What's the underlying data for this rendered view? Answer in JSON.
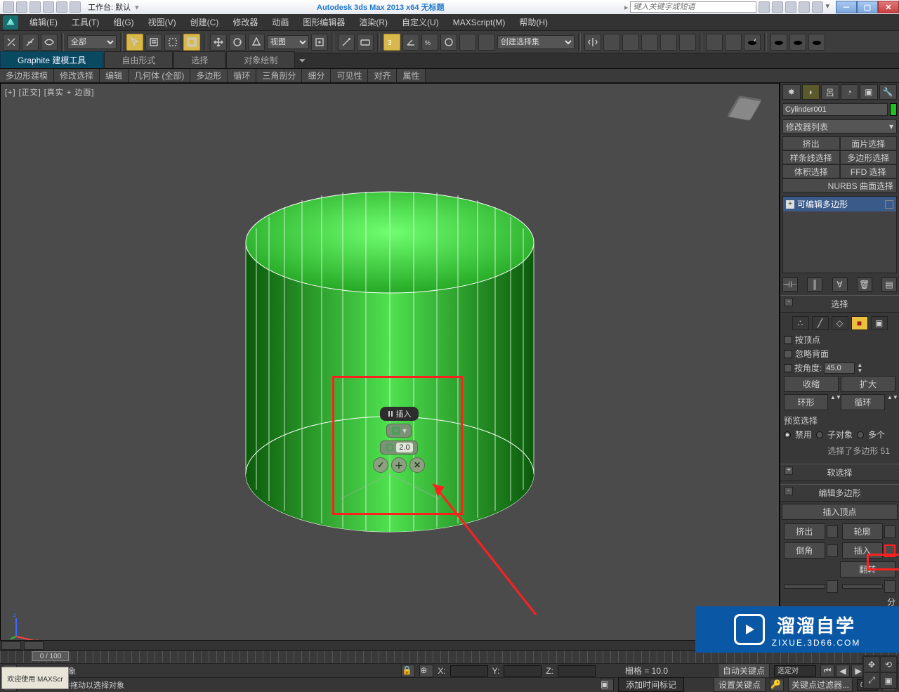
{
  "titlebar": {
    "workspace": "工作台: 默认",
    "app_title": "Autodesk 3ds Max  2013 x64      无标题",
    "search_placeholder": "键入关键字或短语"
  },
  "menu": [
    "编辑(E)",
    "工具(T)",
    "组(G)",
    "视图(V)",
    "创建(C)",
    "修改器",
    "动画",
    "图形编辑器",
    "渲染(R)",
    "自定义(U)",
    "MAXScript(M)",
    "帮助(H)"
  ],
  "main_toolbar": {
    "selection_filter": "全部",
    "ref_coord": "视图",
    "named_sel_set": "创建选择集"
  },
  "ribbon": {
    "tabs": [
      "Graphite 建模工具",
      "自由形式",
      "选择",
      "对象绘制"
    ],
    "panels": [
      "多边形建模",
      "修改选择",
      "编辑",
      "几何体 (全部)",
      "多边形",
      "循环",
      "三角剖分",
      "细分",
      "可见性",
      "对齐",
      "属性"
    ]
  },
  "viewport": {
    "label": "[+] [正交] [真实 + 边面]"
  },
  "caddy": {
    "title": "插入",
    "value": "2.0"
  },
  "cmdpanel": {
    "object_name": "Cylinder001",
    "modifier_dd": "修改器列表",
    "mod_buttons": [
      "挤出",
      "面片选择",
      "样条线选择",
      "多边形选择",
      "体积选择",
      "FFD 选择"
    ],
    "nurbs": "NURBS 曲面选择",
    "stack_item": "可编辑多边形",
    "roll_select": "选择",
    "chk_byvertex": "按顶点",
    "chk_ignoreback": "忽略背面",
    "chk_byangle": "按角度:",
    "angle_val": "45.0",
    "btn_shrink": "收缩",
    "btn_grow": "扩大",
    "btn_ring": "环形",
    "btn_loop": "循环",
    "preview_label": "预览选择",
    "r_disable": "禁用",
    "r_subobj": "子对象",
    "r_multi": "多个",
    "sel_status": "选择了多边形 51",
    "roll_softsel": "软选择",
    "roll_editpoly": "编辑多边形",
    "insert_vertex": "插入顶点",
    "ep_extrude": "挤出",
    "ep_outline": "轮廓",
    "ep_bevel": "倒角",
    "ep_inset": "插入",
    "ep_flip": "翻转",
    "ep_more": "分"
  },
  "timeline": {
    "frame": "0 / 100"
  },
  "status": {
    "sel_count": "选择了 1 个对象",
    "prompt": "单击或单击并拖动以选择对象",
    "x": "X:",
    "y": "Y:",
    "z": "Z:",
    "grid": "栅格 = 10.0",
    "addtimetag": "添加时间标记",
    "autokey": "自动关键点",
    "setkey": "设置关键点",
    "selset": "选定对",
    "keyfilter": "关键点过滤器..."
  },
  "welcome": "欢迎使用  MAXScr",
  "watermark": {
    "big": "溜溜自学",
    "small": "ZIXUE.3D66.COM"
  }
}
